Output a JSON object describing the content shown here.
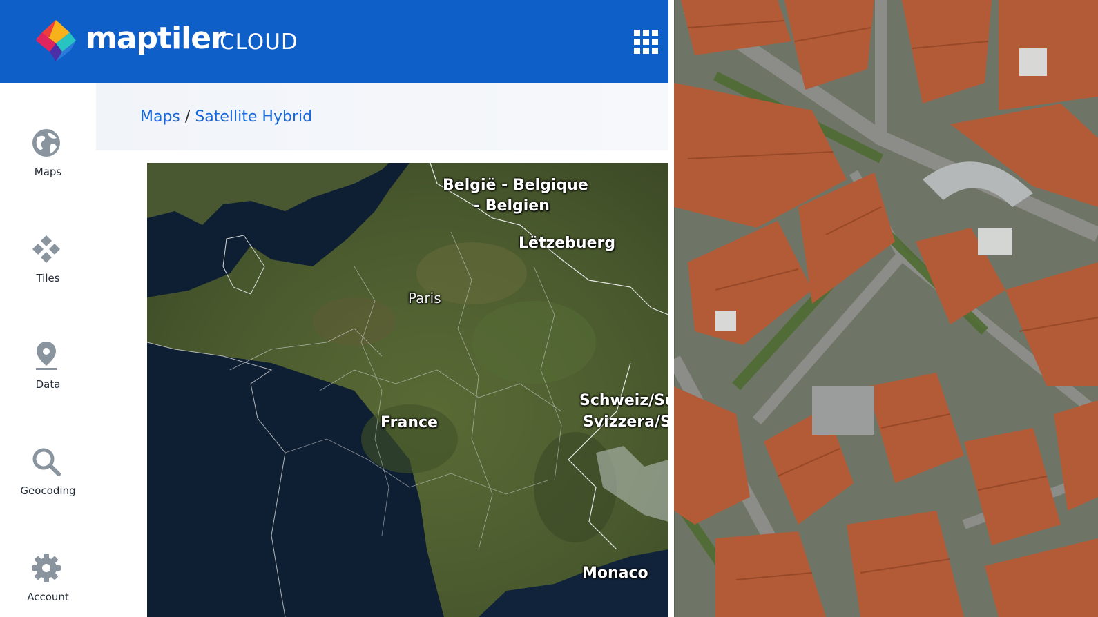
{
  "header": {
    "brand": "maptiler",
    "brand_sub": "CLOUD",
    "brand_color": "#0f5fc9",
    "apps_icon": "grid-icon"
  },
  "sidebar": {
    "items": [
      {
        "label": "Maps",
        "icon": "globe-icon"
      },
      {
        "label": "Tiles",
        "icon": "tiles-icon"
      },
      {
        "label": "Data",
        "icon": "map-pin-icon"
      },
      {
        "label": "Geocoding",
        "icon": "search-icon"
      },
      {
        "label": "Account",
        "icon": "gear-icon"
      }
    ]
  },
  "breadcrumb": {
    "root": "Maps",
    "separator": "/",
    "current": "Satellite Hybrid"
  },
  "map": {
    "labels": {
      "belgium_1": "België - Belgique",
      "belgium_2": "- Belgien",
      "luxembourg": "Lëtzebuerg",
      "paris": "Paris",
      "switzerland_1": "Schweiz/Su",
      "switzerland_2": "Svizzera/Sv",
      "france": "France",
      "monaco": "Monaco"
    }
  },
  "colors": {
    "link": "#1668db",
    "nav_icon": "#8a949e"
  }
}
